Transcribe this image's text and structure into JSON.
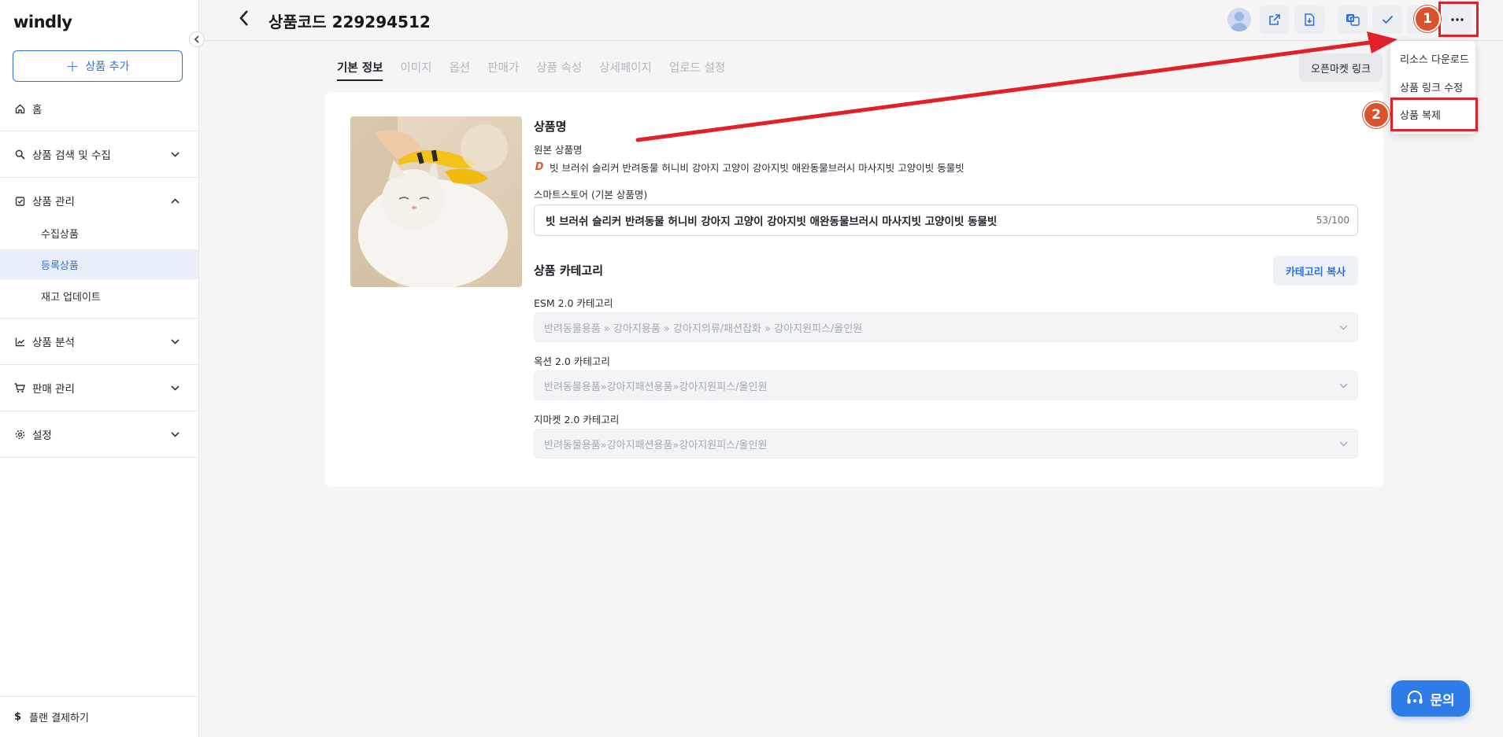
{
  "app": {
    "logo": "windly"
  },
  "sidebar": {
    "add_button": "상품 추가",
    "home": "홈",
    "search_collect": "상품 검색 및 수집",
    "product_manage": "상품 관리",
    "sub_items": [
      "수집상품",
      "등록상품",
      "재고 업데이트"
    ],
    "analysis": "상품 분석",
    "sales_manage": "판매 관리",
    "settings": "설정",
    "plan": "플랜 결제하기"
  },
  "header": {
    "title": "상품코드 229294512"
  },
  "tabs": [
    "기본 정보",
    "이미지",
    "옵션",
    "판매가",
    "상품 속성",
    "상세페이지",
    "업로드 설정"
  ],
  "openmarket_link": "오픈마켓 링크",
  "product": {
    "name_section": "상품명",
    "orig_label": "원본 상품명",
    "orig_name": "빗 브러쉬 슬리커 반려동물 허니비 강아지 고양이 강아지빗 애완동물브러시 마사지빗 고양이빗 동물빗",
    "smartstore_label": "스마트스토어 (기본 상품명)",
    "smartstore_name": "빗 브러쉬 슬리커 반려동물 허니비 강아지 고양이 강아지빗 애완동물브러시 마사지빗 고양이빗 동물빗",
    "name_count": "53/100"
  },
  "category": {
    "section": "상품 카테고리",
    "copy_button": "카테고리 복사",
    "esm_label": "ESM 2.0 카테고리",
    "esm_value": "반려동물용품 » 강아지용품 » 강아지의류/패션잡화 » 강아지원피스/올인원",
    "auction_label": "옥션 2.0 카테고리",
    "auction_value": "반려동물용품»강아지패션용품»강아지원피스/올인원",
    "gmarket_label": "지마켓 2.0 카테고리",
    "gmarket_value": "반려동물용품»강아지패션용품»강아지원피스/올인원"
  },
  "menu": {
    "items": [
      "리소스 다운로드",
      "상품 링크 수정",
      "상품 복제"
    ]
  },
  "annotations": {
    "step1": "1",
    "step2": "2"
  },
  "inquiry": "문의",
  "colors": {
    "accent": "#2f6fe0",
    "highlight": "#e0202a",
    "badge": "#d9532f"
  }
}
